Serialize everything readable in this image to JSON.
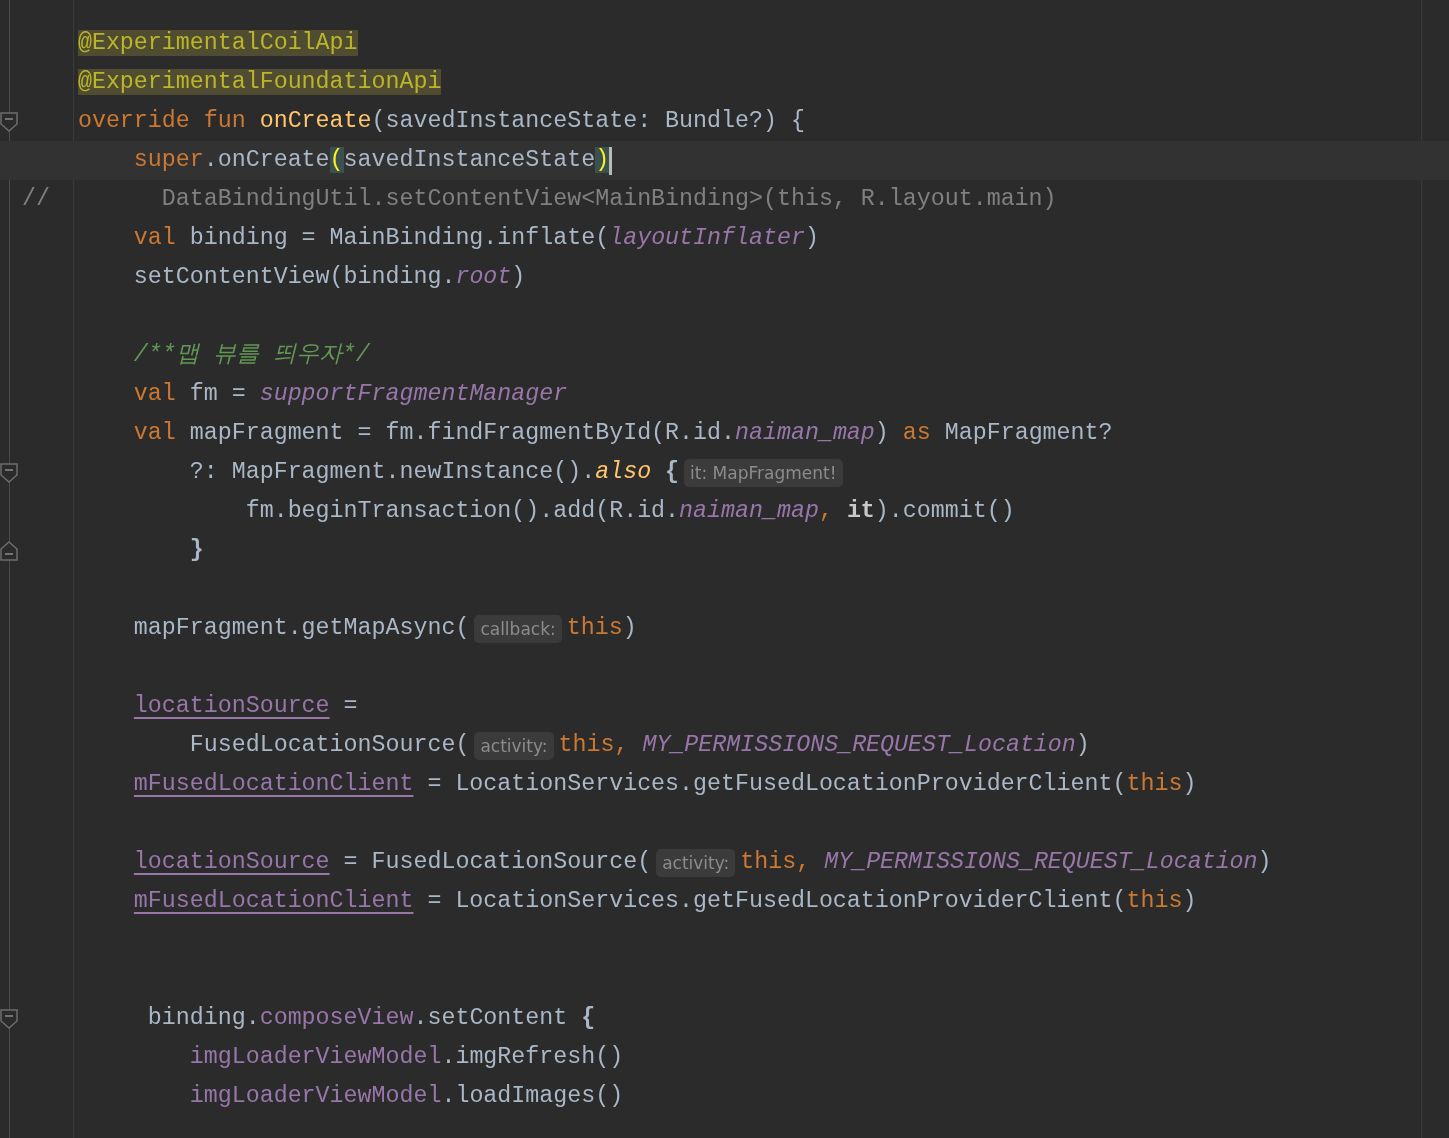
{
  "editor": {
    "blocks": [
      {
        "lines": [
          {
            "tokens": [
              {
                "text": "    @ExperimentalCoilApi",
                "kind": "annotation"
              }
            ]
          },
          {
            "tokens": [
              {
                "text": "    @ExperimentalFoundationApi",
                "kind": "annotation"
              }
            ]
          },
          {
            "fold_start": true,
            "tokens": [
              {
                "text": "    override fun ",
                "kind": "keyword"
              },
              {
                "text": "onCreate",
                "kind": "function"
              },
              {
                "text": "(savedInstanceState: Bundle?) {",
                "kind": "plain"
              }
            ]
          },
          {
            "current": true,
            "caret": true,
            "tokens": [
              {
                "text": "        super",
                "kind": "keyword"
              },
              {
                "text": ".onCreate",
                "kind": "plain"
              },
              {
                "text": "(",
                "kind": "bracket-match"
              },
              {
                "text": "savedInstanceState",
                "kind": "plain"
              },
              {
                "text": ")",
                "kind": "bracket-match"
              }
            ]
          },
          {
            "tokens": [
              {
                "text": "//        DataBindingUtil.setContentView<MainBinding>(this, R.layout.main)",
                "kind": "line-comment"
              }
            ]
          },
          {
            "tokens": [
              {
                "text": "        val ",
                "kind": "keyword"
              },
              {
                "text": "binding = MainBinding.inflate(",
                "kind": "plain"
              },
              {
                "text": "layoutInflater",
                "kind": "field"
              },
              {
                "text": ")",
                "kind": "plain"
              }
            ]
          },
          {
            "tokens": [
              {
                "text": "        setContentView(binding.",
                "kind": "plain"
              },
              {
                "text": "root",
                "kind": "field"
              },
              {
                "text": ")",
                "kind": "plain"
              }
            ]
          }
        ]
      },
      {
        "lines": [
          {
            "tokens": [
              {
                "text": "        /**맵 뷰를 띄우자*/",
                "kind": "doc-comment"
              }
            ]
          },
          {
            "tokens": [
              {
                "text": "        val ",
                "kind": "keyword"
              },
              {
                "text": "fm = ",
                "kind": "plain"
              },
              {
                "text": "supportFragmentManager",
                "kind": "field"
              }
            ]
          },
          {
            "tokens": [
              {
                "text": "        val ",
                "kind": "keyword"
              },
              {
                "text": "mapFragment = fm.findFragmentById(R.id.",
                "kind": "plain"
              },
              {
                "text": "naiman_map",
                "kind": "field"
              },
              {
                "text": ") ",
                "kind": "plain"
              },
              {
                "text": "as ",
                "kind": "keyword"
              },
              {
                "text": "MapFragment?",
                "kind": "plain"
              }
            ]
          },
          {
            "fold_start": true,
            "tokens": [
              {
                "text": "            ?: MapFragment.newInstance().",
                "kind": "plain"
              },
              {
                "text": "also",
                "kind": "extension"
              },
              {
                "text": " {",
                "kind": "brace"
              },
              {
                "text": "it: MapFragment!",
                "kind": "hint"
              }
            ]
          },
          {
            "tokens": [
              {
                "text": "                fm.beginTransaction().add(R.id.",
                "kind": "plain"
              },
              {
                "text": "naiman_map",
                "kind": "field"
              },
              {
                "text": ", ",
                "kind": "keyword"
              },
              {
                "text": "it",
                "kind": "implicit"
              },
              {
                "text": ").commit()",
                "kind": "plain"
              }
            ]
          },
          {
            "fold_end": true,
            "tokens": [
              {
                "text": "            }",
                "kind": "brace"
              }
            ]
          }
        ]
      },
      {
        "lines": [
          {
            "tokens": [
              {
                "text": "        mapFragment.getMapAsync(",
                "kind": "plain"
              },
              {
                "text": "callback:",
                "kind": "hint"
              },
              {
                "text": "this",
                "kind": "keyword"
              },
              {
                "text": ")",
                "kind": "plain"
              }
            ]
          }
        ]
      },
      {
        "lines": [
          {
            "tokens": [
              {
                "text": "        locationSource",
                "kind": "property-ref"
              },
              {
                "text": " =",
                "kind": "plain"
              }
            ]
          },
          {
            "tokens": [
              {
                "text": "            FusedLocationSource(",
                "kind": "plain"
              },
              {
                "text": "activity:",
                "kind": "hint"
              },
              {
                "text": "this, ",
                "kind": "keyword"
              },
              {
                "text": "MY_PERMISSIONS_REQUEST_Location",
                "kind": "field"
              },
              {
                "text": ")",
                "kind": "plain"
              }
            ]
          },
          {
            "tokens": [
              {
                "text": "        mFusedLocationClient",
                "kind": "property-ref"
              },
              {
                "text": " = LocationServices.getFusedLocationProviderClient(",
                "kind": "plain"
              },
              {
                "text": "this",
                "kind": "keyword"
              },
              {
                "text": ")",
                "kind": "plain"
              }
            ]
          }
        ]
      },
      {
        "lines": [
          {
            "tokens": [
              {
                "text": "        locationSource",
                "kind": "property-ref"
              },
              {
                "text": " = FusedLocationSource(",
                "kind": "plain"
              },
              {
                "text": "activity:",
                "kind": "hint"
              },
              {
                "text": "this, ",
                "kind": "keyword"
              },
              {
                "text": "MY_PERMISSIONS_REQUEST_Location",
                "kind": "field"
              },
              {
                "text": ")",
                "kind": "plain"
              }
            ]
          },
          {
            "tokens": [
              {
                "text": "        mFusedLocationClient",
                "kind": "property-ref"
              },
              {
                "text": " = LocationServices.getFusedLocationProviderClient(",
                "kind": "plain"
              },
              {
                "text": "this",
                "kind": "keyword"
              },
              {
                "text": ")",
                "kind": "plain"
              }
            ]
          }
        ]
      },
      {
        "wide_gap_before": true,
        "lines": [
          {
            "fold_start": true,
            "tokens": [
              {
                "text": "         binding.",
                "kind": "plain"
              },
              {
                "text": "composeView",
                "kind": "property"
              },
              {
                "text": ".setContent ",
                "kind": "plain"
              },
              {
                "text": "{",
                "kind": "brace"
              }
            ]
          },
          {
            "tokens": [
              {
                "text": "            imgLoaderViewModel",
                "kind": "property"
              },
              {
                "text": ".imgRefresh()",
                "kind": "plain"
              }
            ]
          },
          {
            "tokens": [
              {
                "text": "            imgLoaderViewModel",
                "kind": "property"
              },
              {
                "text": ".loadImages()",
                "kind": "plain"
              }
            ]
          }
        ]
      }
    ]
  }
}
